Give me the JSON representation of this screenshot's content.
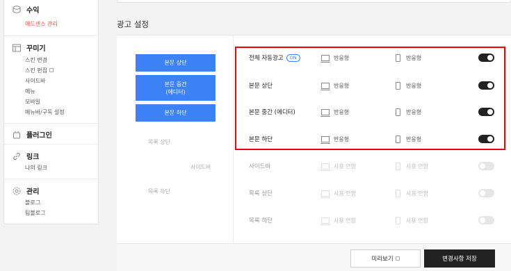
{
  "sidebar": {
    "revenue": {
      "title": "수익",
      "icon": "coins-icon",
      "items": [
        {
          "label": "애드센스 관리",
          "active": true
        }
      ]
    },
    "customize": {
      "title": "꾸미기",
      "icon": "layout-icon",
      "items": [
        {
          "label": "스킨 변경"
        },
        {
          "label": "스킨 편집",
          "external": true
        },
        {
          "label": "사이드바"
        },
        {
          "label": "메뉴"
        },
        {
          "label": "모바일"
        },
        {
          "label": "메뉴바/구독 설정"
        }
      ]
    },
    "plugin": {
      "title": "플러그인",
      "icon": "plugin-icon"
    },
    "link": {
      "title": "링크",
      "icon": "link-icon",
      "items": [
        {
          "label": "나의 링크"
        }
      ]
    },
    "manage": {
      "title": "관리",
      "icon": "gear-icon",
      "items": [
        {
          "label": "블로그"
        },
        {
          "label": "팀블로그"
        }
      ]
    }
  },
  "main": {
    "title": "광고 설정",
    "preview": {
      "buttons": [
        "본문 상단",
        "본문 중간\n(에디터)",
        "본문 하단"
      ],
      "labels": {
        "list_top": "목록 상단",
        "sidebar": "사이드바",
        "list_bottom": "목록 하단"
      }
    },
    "rows": [
      {
        "name": "전체 자동광고",
        "badge": "ON",
        "pc": "반응형",
        "mobile": "반응형",
        "enabled": true
      },
      {
        "name": "본문 상단",
        "pc": "반응형",
        "mobile": "반응형",
        "enabled": true
      },
      {
        "name": "본문 중간 (에디터)",
        "pc": "반응형",
        "mobile": "반응형",
        "enabled": true
      },
      {
        "name": "본문 하단",
        "pc": "반응형",
        "mobile": "반응형",
        "enabled": true
      },
      {
        "name": "사이드바",
        "pc": "사용 안함",
        "mobile": "사용 안함",
        "enabled": false
      },
      {
        "name": "목록 상단",
        "pc": "사용 안함",
        "mobile": "사용 안함",
        "enabled": false
      },
      {
        "name": "목록 하단",
        "pc": "사용 안함",
        "mobile": "사용 안함",
        "enabled": false
      }
    ],
    "footer": {
      "preview_label": "미리보기",
      "save_label": "변경사항 저장"
    }
  },
  "colors": {
    "accent": "#3c82f6",
    "active_menu": "#f0493e",
    "highlight": "#ee0000",
    "toggle_on": "#222222"
  }
}
